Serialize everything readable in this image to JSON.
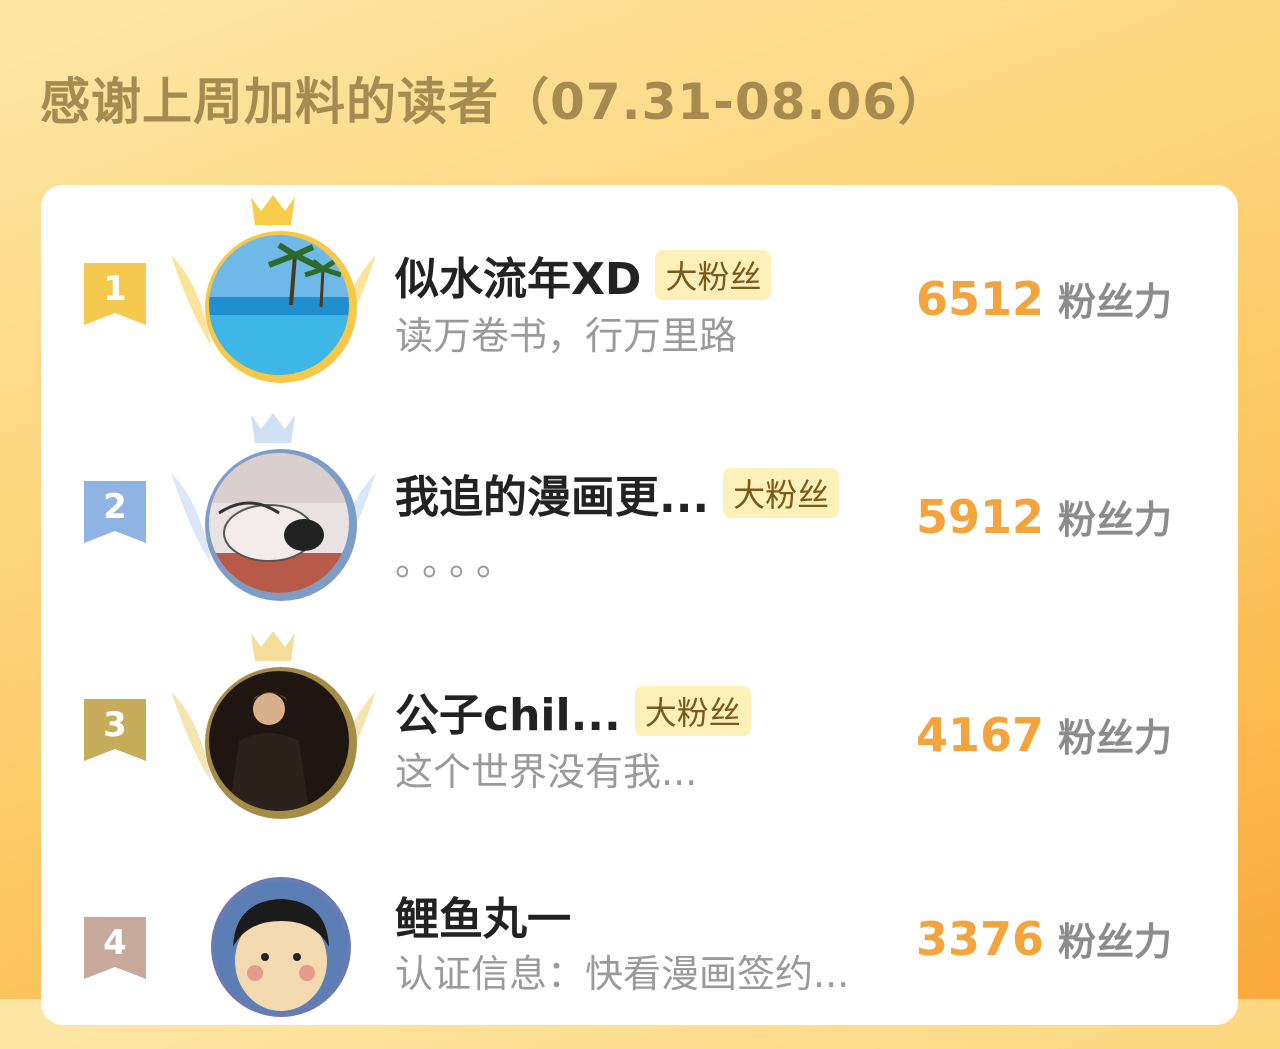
{
  "header": {
    "title": "感谢上周加料的读者（07.31-08.06）"
  },
  "colors": {
    "score": "#f3a43c",
    "badge_bg": "#fdf0b8",
    "rank1": "#f5c84e",
    "rank2": "#8fb3e3",
    "rank3": "#c7ad5b",
    "rank4": "#c6a99a"
  },
  "readers": [
    {
      "rank": "1",
      "name": "似水流年XD",
      "badge": "大粉丝",
      "signature": "读万卷书，行万里路",
      "score": "6512",
      "score_unit": "粉丝力"
    },
    {
      "rank": "2",
      "name": "我追的漫画更...",
      "badge": "大粉丝",
      "signature": "。。。。",
      "score": "5912",
      "score_unit": "粉丝力"
    },
    {
      "rank": "3",
      "name": "公子chil...",
      "badge": "大粉丝",
      "signature": "这个世界没有我...",
      "score": "4167",
      "score_unit": "粉丝力"
    },
    {
      "rank": "4",
      "name": "鲤鱼丸一",
      "badge": "",
      "signature": "认证信息：快看漫画签约...",
      "score": "3376",
      "score_unit": "粉丝力"
    }
  ]
}
